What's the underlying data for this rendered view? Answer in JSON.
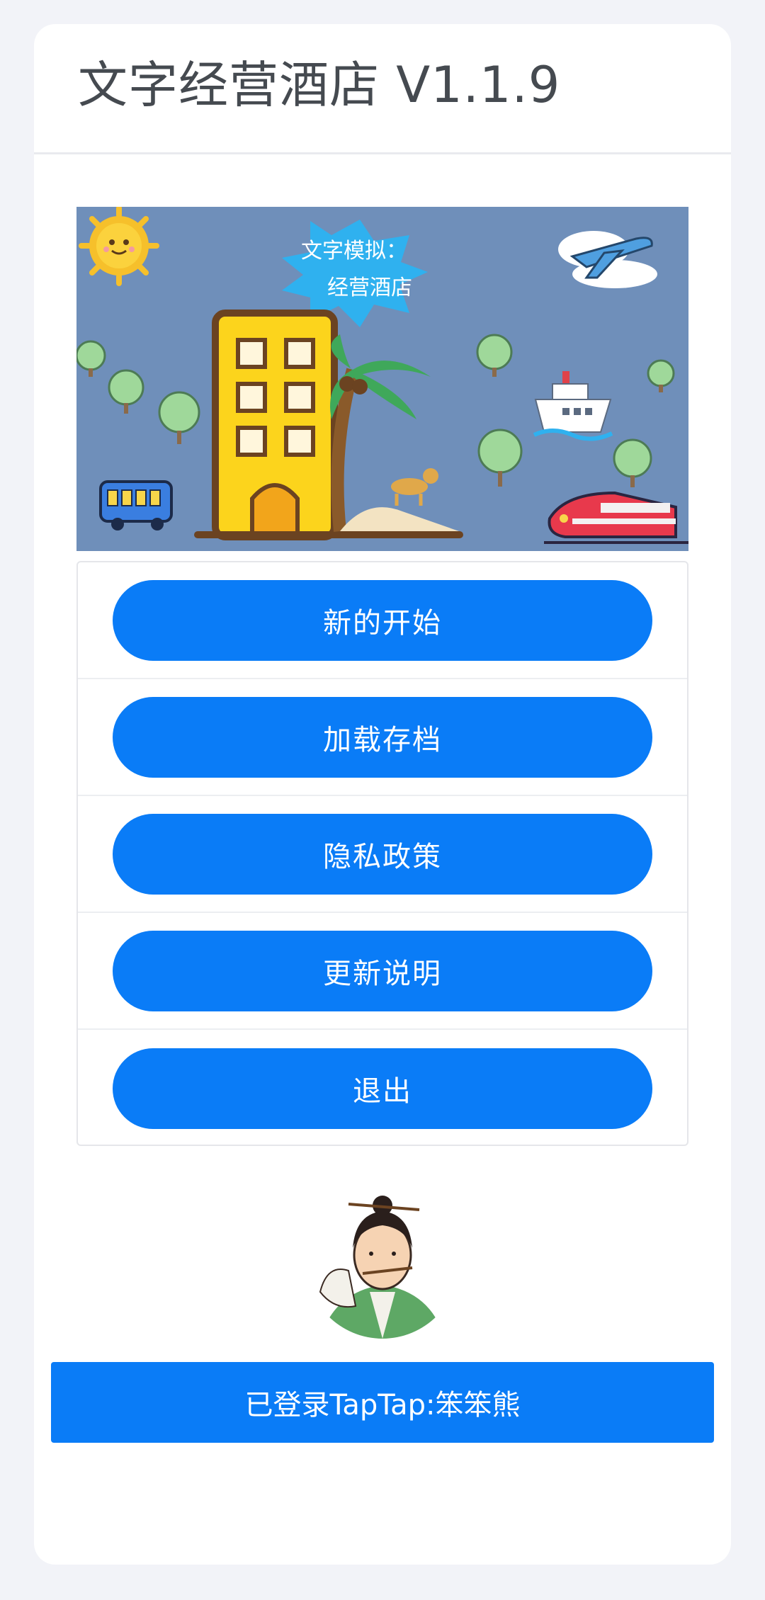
{
  "header": {
    "title": "文字经营酒店 V1.1.9"
  },
  "banner": {
    "line1": "文字模拟：",
    "line2": "经营酒店"
  },
  "menu": {
    "items": [
      {
        "label": "新的开始"
      },
      {
        "label": "加载存档"
      },
      {
        "label": "隐私政策"
      },
      {
        "label": "更新说明"
      },
      {
        "label": "退出"
      }
    ]
  },
  "avatar": {
    "icon": "avatar-portrait"
  },
  "login": {
    "label": "已登录TapTap:笨笨熊"
  },
  "colors": {
    "accent": "#0a7cf7",
    "background": "#f2f3f8",
    "banner_bg": "#6f8fba"
  }
}
